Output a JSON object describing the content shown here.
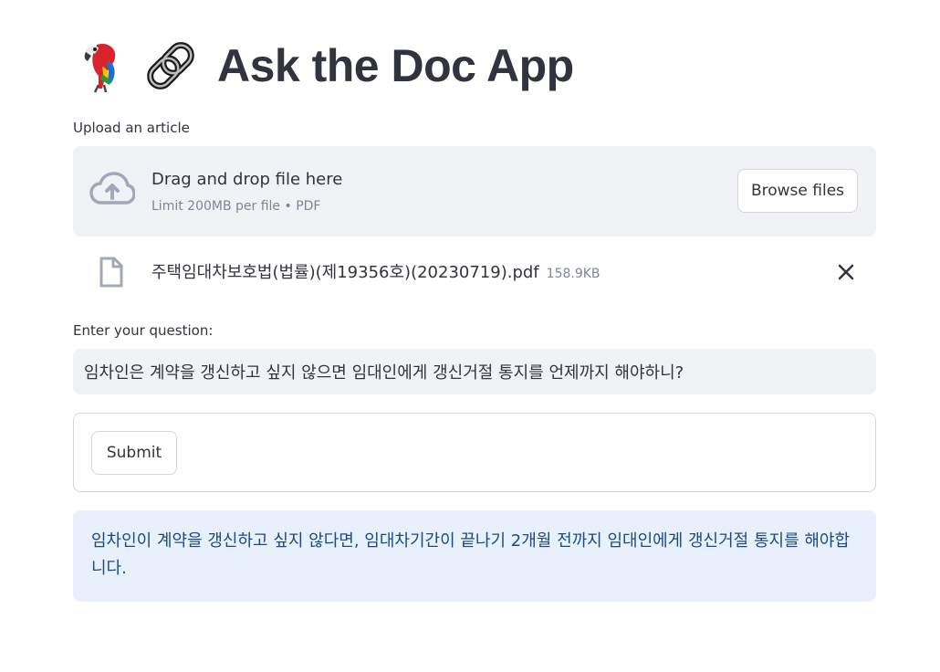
{
  "header": {
    "title": "Ask the Doc App",
    "icons": [
      "parrot-emoji",
      "chain-link-emoji"
    ]
  },
  "uploader": {
    "label": "Upload an article",
    "drop_text": "Drag and drop file here",
    "limit_text": "Limit 200MB per file • PDF",
    "browse_label": "Browse files",
    "icon": "cloud-upload-icon",
    "file": {
      "icon": "file-icon",
      "name": "주택임대차보호법(법률)(제19356호)(20230719).pdf",
      "size": "158.9KB",
      "remove_icon": "close-icon"
    }
  },
  "question": {
    "label": "Enter your question:",
    "value": "임차인은 계약을 갱신하고 싶지 않으면 임대인에게 갱신거절 통지를 언제까지 해야하니?"
  },
  "form": {
    "submit_label": "Submit"
  },
  "answer": {
    "text": "임차인이 계약을 갱신하고 싶지 않다면, 임대차기간이 끝나기 2개월 전까지 임대인에게 갱신거절 통지를 해야합니다."
  },
  "colors": {
    "text": "#31333f",
    "muted": "#808495",
    "panel_bg": "#f0f2f6",
    "info_bg": "#e8f1fb",
    "info_text": "#1d4a7c",
    "border": "#d6d6d9"
  }
}
